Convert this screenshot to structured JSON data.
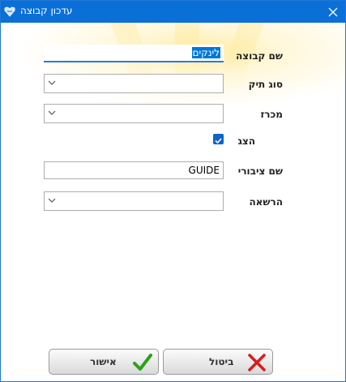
{
  "window": {
    "title": "עדכון קבוצה"
  },
  "form": {
    "group_name": {
      "label": "שם קבוצה",
      "value_selected": "לינקים"
    },
    "file_type": {
      "label": "סוג תיק",
      "value": ""
    },
    "tender": {
      "label": "מכרז",
      "value": ""
    },
    "display": {
      "label": "הצג",
      "checked": true
    },
    "public_name": {
      "label": "שם ציבורי",
      "value": "GUIDE"
    },
    "permission": {
      "label": "הרשאה",
      "value": ""
    }
  },
  "buttons": {
    "cancel_label": "ביטול",
    "ok_label": "אישור"
  },
  "colors": {
    "titlebar": "#0b6fd8",
    "accent": "#0078d7",
    "ok_icon": "#2ea11a",
    "cancel_icon": "#d61c1c"
  },
  "icons": {
    "app": "heart-logo-icon",
    "close": "close-icon",
    "combo": "chevron-down-icon",
    "ok": "checkmark-icon",
    "cancel": "x-icon"
  }
}
